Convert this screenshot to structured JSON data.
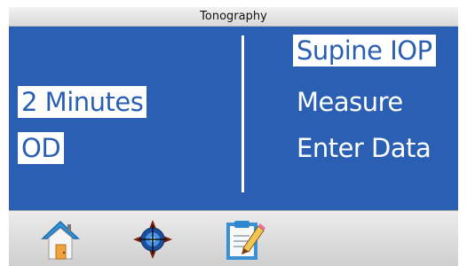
{
  "window": {
    "title": "Tonography"
  },
  "left_menu": {
    "duration": "2 Minutes",
    "eye": "OD"
  },
  "right_menu": {
    "supine": "Supine IOP",
    "measure": "Measure",
    "enter_data": "Enter Data"
  },
  "toolbar": {
    "icons": [
      "home-icon",
      "target-icon",
      "clipboard-pencil-icon"
    ]
  },
  "colors": {
    "panel": "#2a5fb4",
    "selected_background": "#ffffff",
    "text": "#ffffff"
  }
}
